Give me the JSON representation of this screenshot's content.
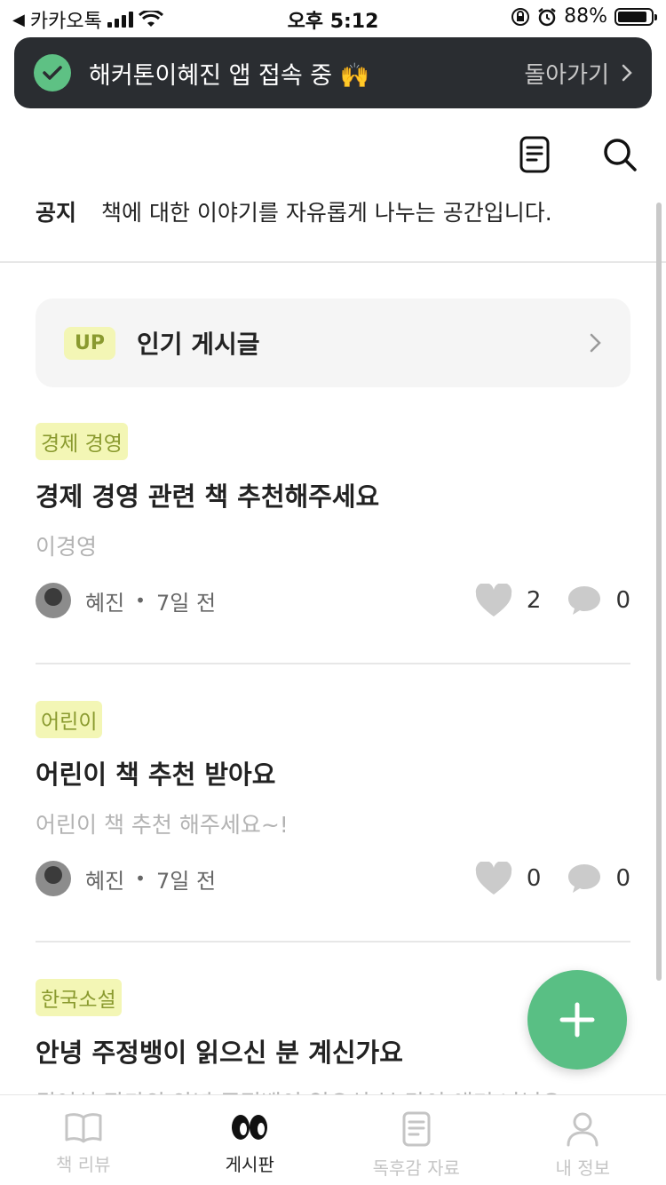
{
  "status_bar": {
    "carrier": "카카오톡",
    "time": "오후 5:12",
    "battery": "88%",
    "battery_level": 0.88
  },
  "banner": {
    "message": "해커톤이혜진 앱 접속 중 🙌",
    "back_label": "돌아가기"
  },
  "toolbar": {
    "icons": [
      "document-icon",
      "search-icon"
    ]
  },
  "notice": {
    "label": "공지",
    "text": "책에 대한 이야기를 자유롭게 나누는 공간입니다."
  },
  "popular": {
    "badge": "UP",
    "label": "인기 게시글"
  },
  "posts": [
    {
      "category": "경제 경영",
      "title": "경제 경영 관련 책 추천해주세요",
      "excerpt": "이경영",
      "author": "혜진",
      "time": "7일 전",
      "likes": "2",
      "comments": "0"
    },
    {
      "category": "어린이",
      "title": "어린이 책 추천 받아요",
      "excerpt": "어린이 책 추천 해주세요~!",
      "author": "혜진",
      "time": "7일 전",
      "likes": "0",
      "comments": "0"
    },
    {
      "category": "한국소설",
      "title": "안녕 주정뱅이 읽으신 분 계신가요",
      "excerpt": "권여선 작가의 안녕 주정뱅이 읽으신 분 같이 얘기 나눠요~!"
    }
  ],
  "fab": {
    "icon": "plus-icon"
  },
  "bottom_nav": [
    {
      "label": "책 리뷰",
      "icon": "book-icon",
      "active": false
    },
    {
      "label": "게시판",
      "icon": "eyes-icon",
      "active": true
    },
    {
      "label": "독후감 자료",
      "icon": "document-icon",
      "active": false
    },
    {
      "label": "내 정보",
      "icon": "person-icon",
      "active": false
    }
  ],
  "colors": {
    "accent_green": "#59bf84",
    "badge_bg": "#f3f6b5",
    "badge_text": "#8a9a2f",
    "banner_bg": "#2a2d31"
  }
}
